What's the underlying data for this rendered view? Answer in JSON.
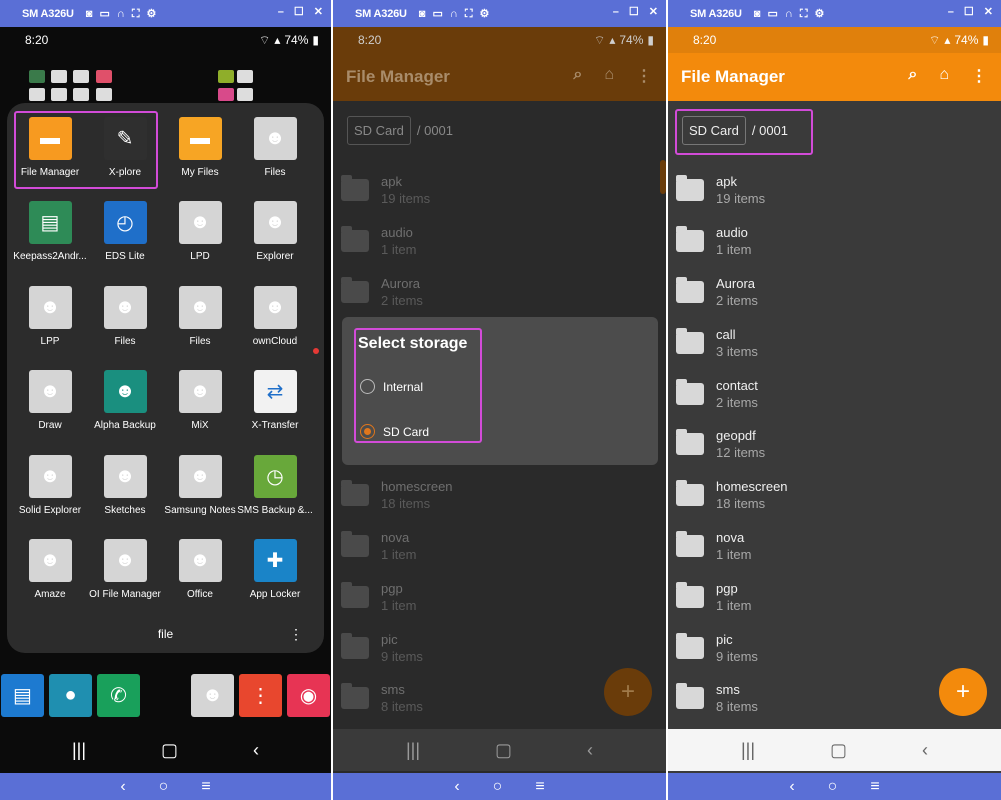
{
  "device": {
    "name": "SM A326U",
    "time": "8:20",
    "battery": "74%"
  },
  "panel1": {
    "apps": [
      {
        "label": "File Manager",
        "icon": "folder-icon",
        "color": "#f79a20"
      },
      {
        "label": "X-plore",
        "icon": "xplore-icon",
        "color": "#2f2f2f"
      },
      {
        "label": "My Files",
        "icon": "folder-icon",
        "color": "#f7a524"
      },
      {
        "label": "Files",
        "icon": "android-icon",
        "color": "#d5d5d5"
      },
      {
        "label": "Keepass2Andr...",
        "icon": "keepass-icon",
        "color": "#2e8b57"
      },
      {
        "label": "EDS Lite",
        "icon": "eds-icon",
        "color": "#1f6fc9"
      },
      {
        "label": "LPD",
        "icon": "android-icon",
        "color": "#d5d5d5"
      },
      {
        "label": "Explorer",
        "icon": "android-icon",
        "color": "#d5d5d5"
      },
      {
        "label": "LPP",
        "icon": "android-icon",
        "color": "#d5d5d5"
      },
      {
        "label": "Files",
        "icon": "android-icon",
        "color": "#d5d5d5"
      },
      {
        "label": "Files",
        "icon": "android-icon",
        "color": "#d5d5d5"
      },
      {
        "label": "ownCloud",
        "icon": "android-icon",
        "color": "#d5d5d5"
      },
      {
        "label": "Draw",
        "icon": "android-icon",
        "color": "#d5d5d5"
      },
      {
        "label": "Alpha Backup",
        "icon": "alpha-backup-icon",
        "color": "#1a8f7f"
      },
      {
        "label": "MiX",
        "icon": "android-icon",
        "color": "#d5d5d5"
      },
      {
        "label": "X-Transfer",
        "icon": "x-transfer-icon",
        "color": "#f2f2f2"
      },
      {
        "label": "Solid Explorer",
        "icon": "android-icon",
        "color": "#d5d5d5"
      },
      {
        "label": "Sketches",
        "icon": "android-icon",
        "color": "#d5d5d5"
      },
      {
        "label": "Samsung Notes",
        "icon": "android-icon",
        "color": "#d5d5d5"
      },
      {
        "label": "SMS Backup &...",
        "icon": "sms-backup-icon",
        "color": "#68a83a"
      },
      {
        "label": "Amaze",
        "icon": "android-icon",
        "color": "#d5d5d5"
      },
      {
        "label": "OI File Manager",
        "icon": "android-icon",
        "color": "#d5d5d5"
      },
      {
        "label": "Office",
        "icon": "android-icon",
        "color": "#d5d5d5"
      },
      {
        "label": "App Locker",
        "icon": "shield-icon",
        "color": "#1a84c8"
      }
    ],
    "folder_name": "file",
    "dock": [
      {
        "icon": "messages-icon",
        "color": "#1d7ad0"
      },
      {
        "icon": "contacts-icon",
        "color": "#1f8fb0"
      },
      {
        "icon": "phone-icon",
        "color": "#19a05b"
      },
      {
        "icon": "android-icon",
        "color": "#d5d5d5"
      },
      {
        "icon": "voice-recorder-icon",
        "color": "#e8472e"
      },
      {
        "icon": "camera-icon",
        "color": "#e73454"
      }
    ]
  },
  "file_manager": {
    "title": "File Manager",
    "crumb_root": "SD Card",
    "crumb_path": "/ 0001",
    "accent": "#f38a0c",
    "folders": [
      {
        "name": "apk",
        "count": "19 items"
      },
      {
        "name": "audio",
        "count": "1 item"
      },
      {
        "name": "Aurora",
        "count": "2 items"
      },
      {
        "name": "call",
        "count": "3 items"
      },
      {
        "name": "contact",
        "count": "2 items"
      },
      {
        "name": "geopdf",
        "count": "12 items"
      },
      {
        "name": "homescreen",
        "count": "18 items"
      },
      {
        "name": "nova",
        "count": "1 item"
      },
      {
        "name": "pgp",
        "count": "1 item"
      },
      {
        "name": "pic",
        "count": "9 items"
      },
      {
        "name": "sms",
        "count": "8 items"
      }
    ]
  },
  "dialog": {
    "title": "Select storage",
    "options": [
      {
        "label": "Internal",
        "selected": false
      },
      {
        "label": "SD Card",
        "selected": true
      }
    ]
  }
}
